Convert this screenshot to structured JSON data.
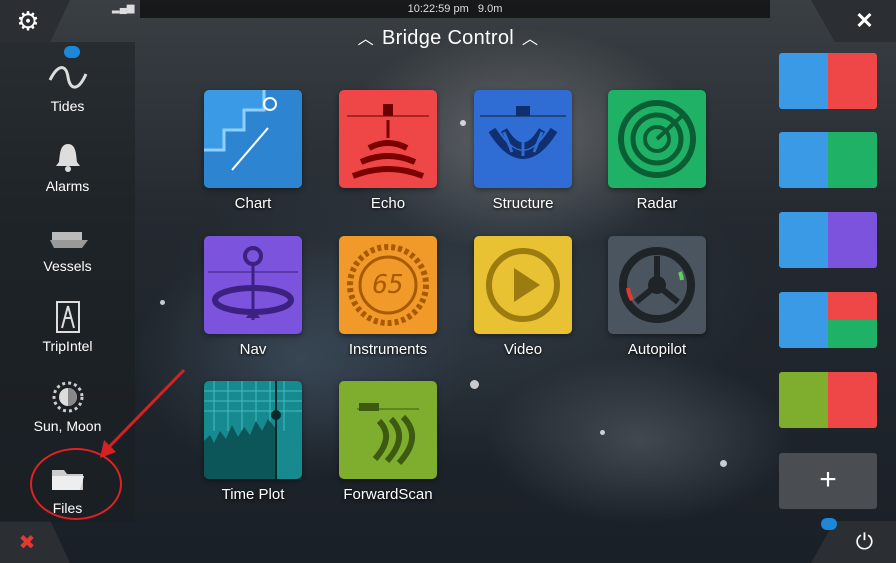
{
  "status": {
    "time": "10:22:59 pm",
    "depth": "9.0m"
  },
  "header": {
    "title": "Bridge Control",
    "chevron_left": "^",
    "chevron_right": "^"
  },
  "corners": {
    "settings_glyph": "⚙",
    "close_glyph": "✕",
    "power_glyph": "⏻",
    "tools_glyph": "✖"
  },
  "sidebar": {
    "items": [
      {
        "label": "Tides",
        "icon": "wave-icon"
      },
      {
        "label": "Alarms",
        "icon": "bell-icon"
      },
      {
        "label": "Vessels",
        "icon": "ship-icon"
      },
      {
        "label": "TripIntel",
        "icon": "compass-divider-icon"
      },
      {
        "label": "Sun, Moon",
        "icon": "sun-moon-icon"
      },
      {
        "label": "Files",
        "icon": "folder-icon"
      }
    ]
  },
  "apps": [
    {
      "label": "Chart",
      "color": "#3a9ae6"
    },
    {
      "label": "Echo",
      "color": "#ef4747"
    },
    {
      "label": "Structure",
      "color": "#2f6cd3"
    },
    {
      "label": "Radar",
      "color": "#1fb266"
    },
    {
      "label": "Nav",
      "color": "#7c53dc"
    },
    {
      "label": "Instruments",
      "color": "#f19a2a",
      "value": "65"
    },
    {
      "label": "Video",
      "color": "#e9c233"
    },
    {
      "label": "Autopilot",
      "color": "#4b5560"
    },
    {
      "label": "Time Plot",
      "color": "#178a90"
    },
    {
      "label": "ForwardScan",
      "color": "#7fae2f"
    }
  ],
  "right_panel": {
    "add_label": "+"
  },
  "annotation": {
    "arrow_color": "#d42222"
  }
}
